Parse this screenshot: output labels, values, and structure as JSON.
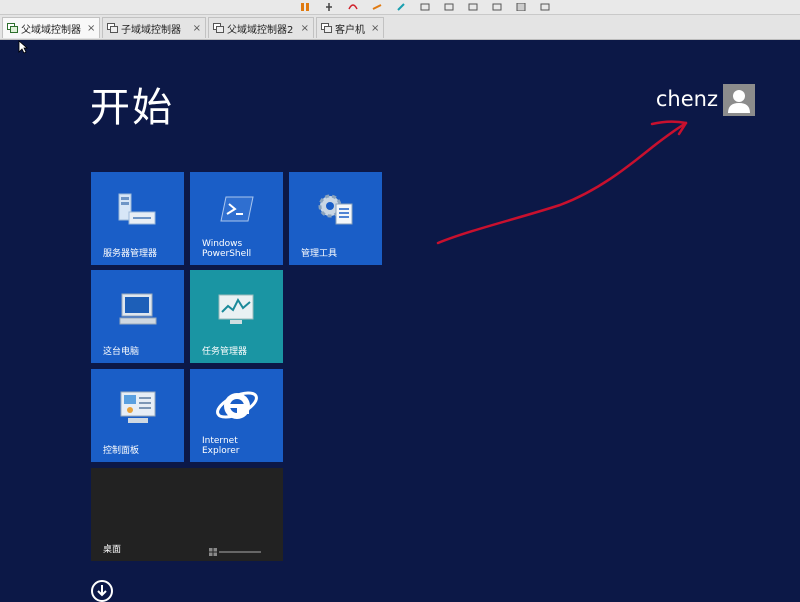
{
  "host": {
    "tabs": [
      {
        "label": "父域域控制器",
        "active": true
      },
      {
        "label": "子域域控制器",
        "active": false
      },
      {
        "label": "父域域控制器2",
        "active": false
      },
      {
        "label": "客户机",
        "active": false
      }
    ],
    "close_glyph": "×"
  },
  "start": {
    "title": "开始",
    "user": {
      "name": "chenz",
      "avatar_icon": "user-silhouette-icon"
    }
  },
  "tiles": {
    "server_manager": {
      "label": "服务器管理器",
      "icon": "server-manager-icon"
    },
    "powershell": {
      "label": "Windows\nPowerShell",
      "icon": "powershell-icon"
    },
    "admin_tools": {
      "label": "管理工具",
      "icon": "admin-tools-icon"
    },
    "this_pc": {
      "label": "这台电脑",
      "icon": "computer-icon"
    },
    "task_manager": {
      "label": "任务管理器",
      "icon": "task-manager-icon"
    },
    "control_panel": {
      "label": "控制面板",
      "icon": "control-panel-icon"
    },
    "ie": {
      "label": "Internet\nExplorer",
      "icon": "internet-explorer-icon"
    },
    "desktop": {
      "label": "桌面",
      "icon": "desktop-icon"
    }
  },
  "colors": {
    "background": "#0c1847",
    "tile_blue": "#1a5ec7",
    "tile_teal": "#1a95a3",
    "tile_desktop": "#222222",
    "annotation_arrow": "#c8102e"
  }
}
